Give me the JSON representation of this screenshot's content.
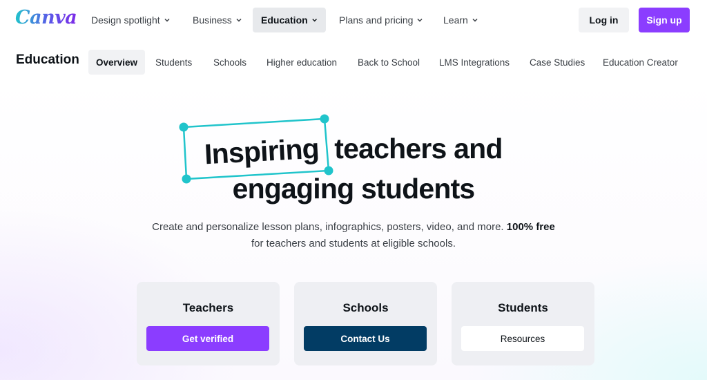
{
  "brand": {
    "logo_text": "Canva",
    "accent": "#8b3dff",
    "teal": "#20c4cb",
    "navy": "#023c64"
  },
  "topnav": {
    "items": [
      {
        "label": "Design spotlight",
        "icon": "chevron-down-icon",
        "active": false
      },
      {
        "label": "Business",
        "icon": "chevron-down-icon",
        "active": false
      },
      {
        "label": "Education",
        "icon": "chevron-down-icon",
        "active": true
      },
      {
        "label": "Plans and pricing",
        "icon": "chevron-down-icon",
        "active": false
      },
      {
        "label": "Learn",
        "icon": "chevron-down-icon",
        "active": false
      }
    ],
    "login_label": "Log in",
    "signup_label": "Sign up"
  },
  "subnav": {
    "title": "Education",
    "items": [
      {
        "label": "Overview",
        "active": true
      },
      {
        "label": "Students"
      },
      {
        "label": "Schools"
      },
      {
        "label": "Higher education"
      },
      {
        "label": "Back to School"
      },
      {
        "label": "LMS Integrations"
      },
      {
        "label": "Case Studies"
      },
      {
        "label": "Education Creator"
      }
    ]
  },
  "hero": {
    "headline_highlight": "Inspiring",
    "headline_line1_rest": "teachers and",
    "headline_line2": "engaging students",
    "description_main": "Create and personalize lesson plans, infographics, posters, video, and more.",
    "description_bold": "100% free",
    "description_end": "for teachers and students at eligible schools."
  },
  "cards": [
    {
      "title": "Teachers",
      "button_label": "Get verified"
    },
    {
      "title": "Schools",
      "button_label": "Contact Us"
    },
    {
      "title": "Students",
      "button_label": "Resources"
    }
  ]
}
